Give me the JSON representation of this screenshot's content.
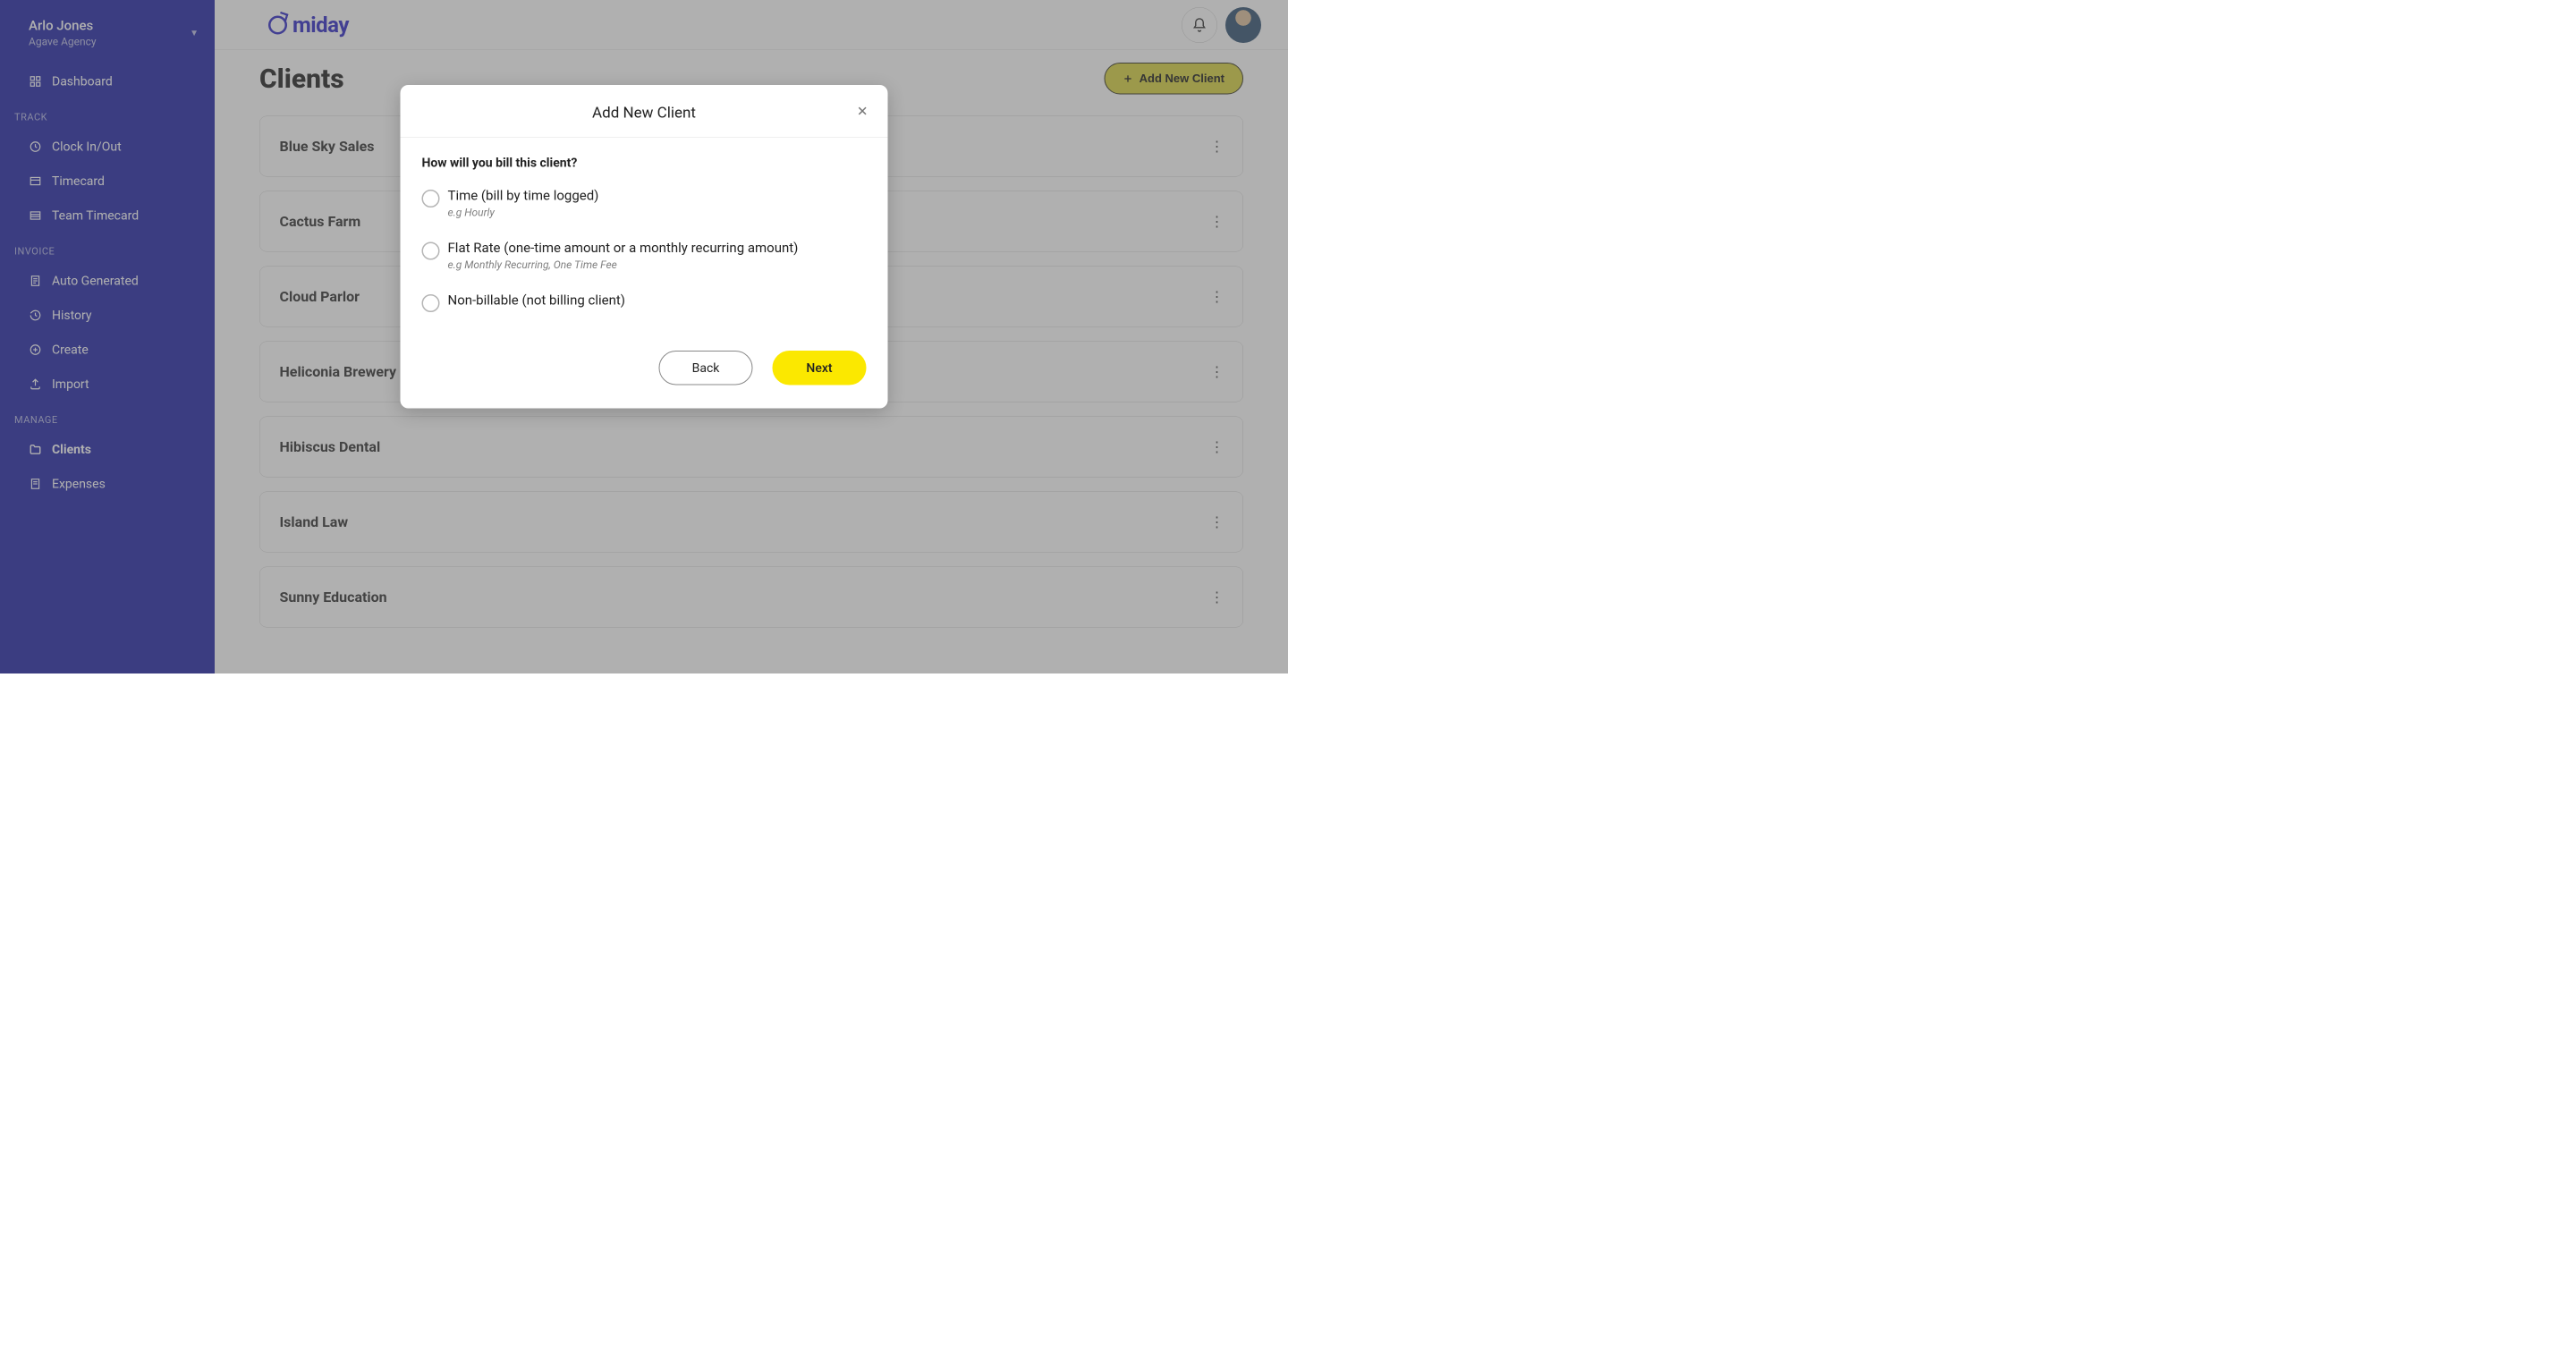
{
  "user": {
    "name": "Arlo Jones",
    "agency": "Agave Agency"
  },
  "brand": "miday",
  "sidebar": {
    "items": [
      {
        "icon": "dashboard-icon",
        "label": "Dashboard"
      }
    ],
    "sections": [
      {
        "label": "TRACK",
        "items": [
          {
            "icon": "clock-icon",
            "label": "Clock In/Out"
          },
          {
            "icon": "timecard-icon",
            "label": "Timecard"
          },
          {
            "icon": "team-timecard-icon",
            "label": "Team Timecard"
          }
        ]
      },
      {
        "label": "INVOICE",
        "items": [
          {
            "icon": "document-icon",
            "label": "Auto Generated"
          },
          {
            "icon": "history-icon",
            "label": "History"
          },
          {
            "icon": "plus-circle-icon",
            "label": "Create"
          },
          {
            "icon": "upload-icon",
            "label": "Import"
          }
        ]
      },
      {
        "label": "MANAGE",
        "items": [
          {
            "icon": "folder-icon",
            "label": "Clients",
            "active": true
          },
          {
            "icon": "receipt-icon",
            "label": "Expenses"
          }
        ]
      }
    ]
  },
  "page": {
    "title": "Clients",
    "add_btn": "Add New Client",
    "clients": [
      "Blue Sky Sales",
      "Cactus Farm",
      "Cloud Parlor",
      "Heliconia Brewery",
      "Hibiscus Dental",
      "Island Law",
      "Sunny Education"
    ]
  },
  "modal": {
    "title": "Add New Client",
    "question": "How will you bill this client?",
    "options": [
      {
        "label": "Time (bill by time logged)",
        "hint": "e.g Hourly"
      },
      {
        "label": "Flat Rate (one-time amount or a monthly recurring amount)",
        "hint": "e.g Monthly Recurring, One Time Fee"
      },
      {
        "label": "Non-billable (not billing client)",
        "hint": ""
      }
    ],
    "back": "Back",
    "next": "Next"
  }
}
